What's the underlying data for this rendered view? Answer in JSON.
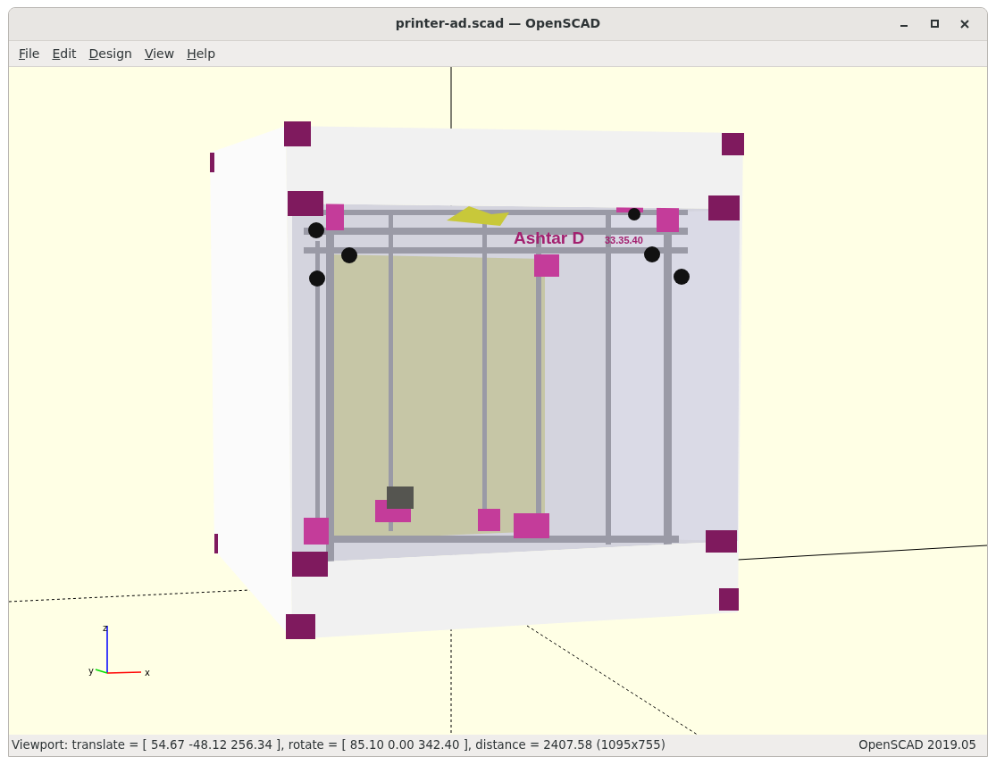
{
  "window": {
    "title": "printer-ad.scad — OpenSCAD"
  },
  "menu": [
    {
      "label": "File"
    },
    {
      "label": "Edit"
    },
    {
      "label": "Design"
    },
    {
      "label": "View"
    },
    {
      "label": "Help"
    }
  ],
  "viewport": {
    "model_label": {
      "name": "Ashtar D",
      "version": "33.35.40"
    },
    "axis_labels": {
      "z": "z",
      "y": "y",
      "x": "x"
    }
  },
  "status_bar": {
    "viewport_info": "Viewport: translate = [ 54.67 -48.12 256.34 ], rotate = [ 85.10 0.00 342.40 ], distance = 2407.58 (1095x755)",
    "version": "OpenSCAD 2019.05"
  }
}
